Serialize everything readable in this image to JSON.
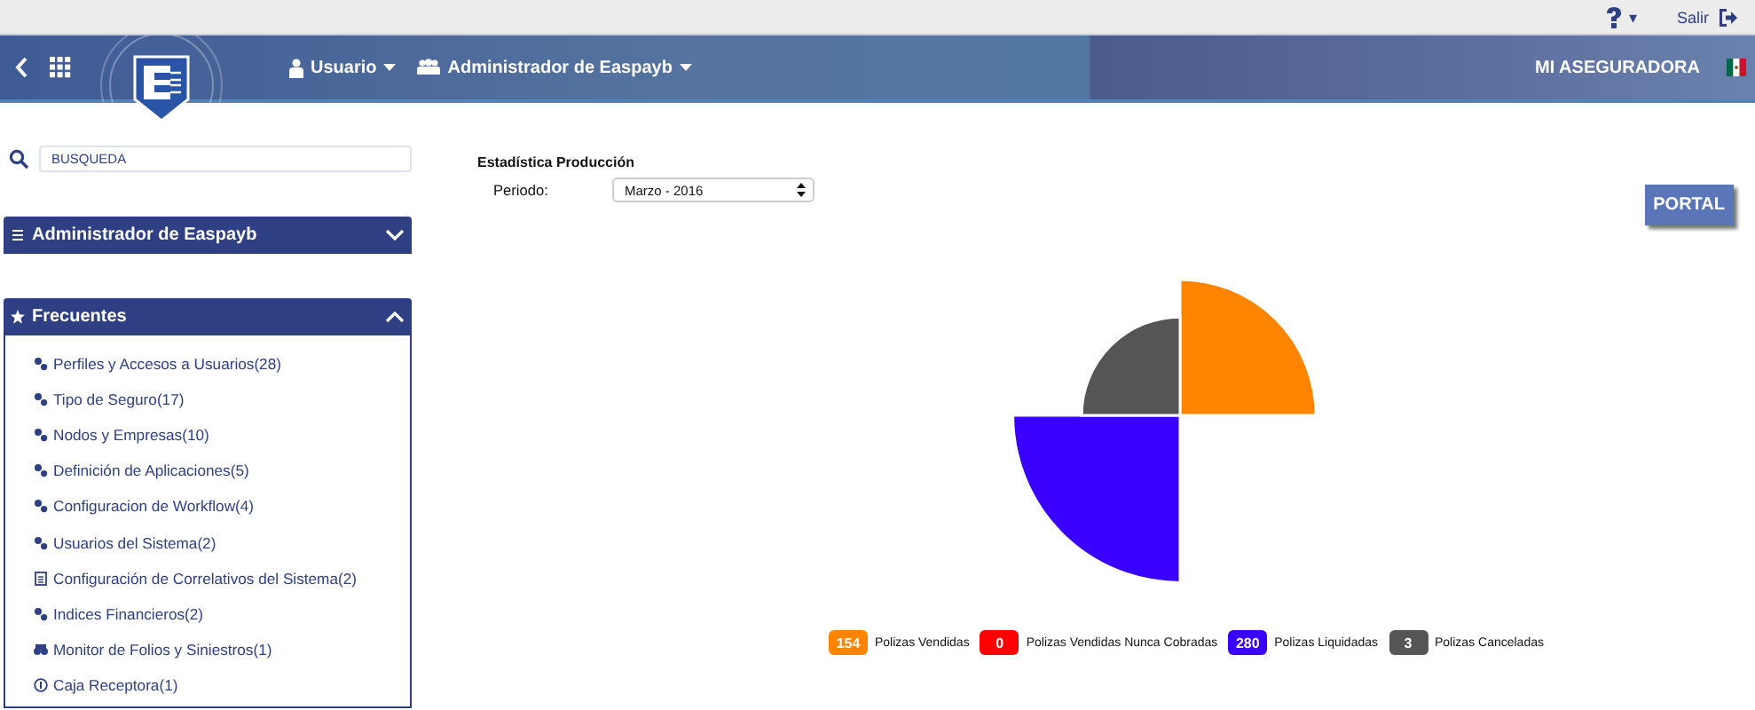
{
  "top_bar": {
    "help_caret": "▾",
    "logout": "Salir"
  },
  "header": {
    "menus": [
      {
        "label": "Usuario",
        "kind": "user"
      },
      {
        "label": "Administrador de Easpayb",
        "kind": "group"
      }
    ],
    "company": "MI ASEGURADORA"
  },
  "sidebar": {
    "search": {
      "value": "BUSQUEDA"
    },
    "panels": [
      {
        "title": "Administrador de Easpayb",
        "kind": "menu",
        "expanded": false
      },
      {
        "title": "Frecuentes",
        "kind": "star",
        "expanded": true,
        "items": [
          {
            "label": "Perfiles y Accesos a Usuarios(28)",
            "kind": "module"
          },
          {
            "label": "Tipo de Seguro(17)",
            "kind": "module"
          },
          {
            "label": "Nodos y Empresas(10)",
            "kind": "module"
          },
          {
            "label": "Definición de Aplicaciones(5)",
            "kind": "module"
          },
          {
            "label": "Configuracion de Workflow(4)",
            "kind": "module"
          },
          {
            "label": "Usuarios del Sistema(2)",
            "kind": "module"
          },
          {
            "label": "Configuración de Correlativos del Sistema(2)",
            "kind": "document"
          },
          {
            "label": "Indices Financieros(2)",
            "kind": "module"
          },
          {
            "label": "Monitor de Folios y Siniestros(1)",
            "kind": "monitor"
          },
          {
            "label": "Caja Receptora(1)",
            "kind": "cash"
          }
        ]
      }
    ]
  },
  "main": {
    "title": "Estadística Producción",
    "period_label": "Periodo:",
    "period_value": "Marzo - 2016",
    "portal_button": "PORTAL",
    "legend": [
      {
        "count": "154",
        "label": "Polizas Vendidas",
        "color": "#ff8400"
      },
      {
        "count": "0",
        "label": "Polizas Vendidas Nunca Cobradas",
        "color": "#ff0000"
      },
      {
        "count": "280",
        "label": "Polizas Liquidadas",
        "color": "#3a00ff"
      },
      {
        "count": "3",
        "label": "Polizas Canceladas",
        "color": "#555555"
      }
    ]
  }
}
